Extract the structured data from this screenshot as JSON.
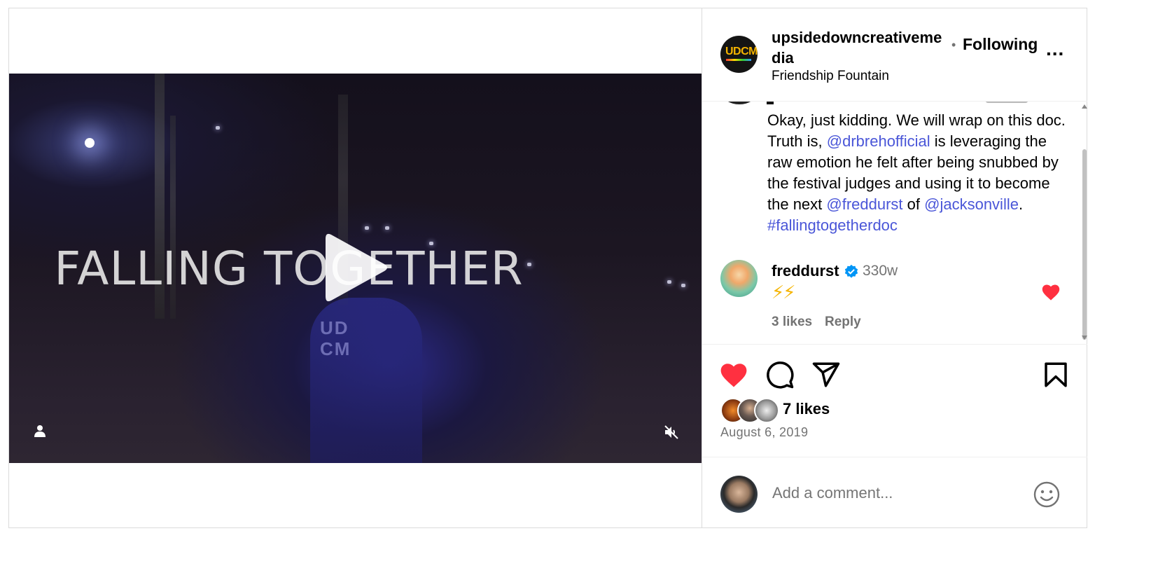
{
  "header": {
    "username": "upsidedowncreativemedia",
    "avatar_text": "UDCM",
    "separator": "•",
    "follow_state": "Following",
    "more_label": "...",
    "location": "Friendship Fountain"
  },
  "video": {
    "title_text": "FALLING TOGETHER",
    "shirt_text": "UD\nCM"
  },
  "caption": {
    "part1": "Okay, just kidding. We will wrap on this doc. Truth is, ",
    "mention1": "@drbrehofficial",
    "part2": " is leveraging the raw emotion he felt after being snubbed by the festival judges and using it to become the next ",
    "mention2": "@freddurst",
    "part3": " of ",
    "mention3": "@jacksonville",
    "part4": ". ",
    "hashtag": "#fallingtogetherdoc"
  },
  "comment": {
    "username": "freddurst",
    "time": "330w",
    "text": "⚡⚡",
    "likes": "3 likes",
    "reply": "Reply"
  },
  "actions": {
    "likes_count": "7 likes",
    "date": "August 6, 2019",
    "comment_placeholder": "Add a comment..."
  },
  "colors": {
    "like_red": "#ff3040",
    "link_blue": "#4a56d8",
    "verified_blue": "#0095f6",
    "secondary_text": "#737373"
  }
}
